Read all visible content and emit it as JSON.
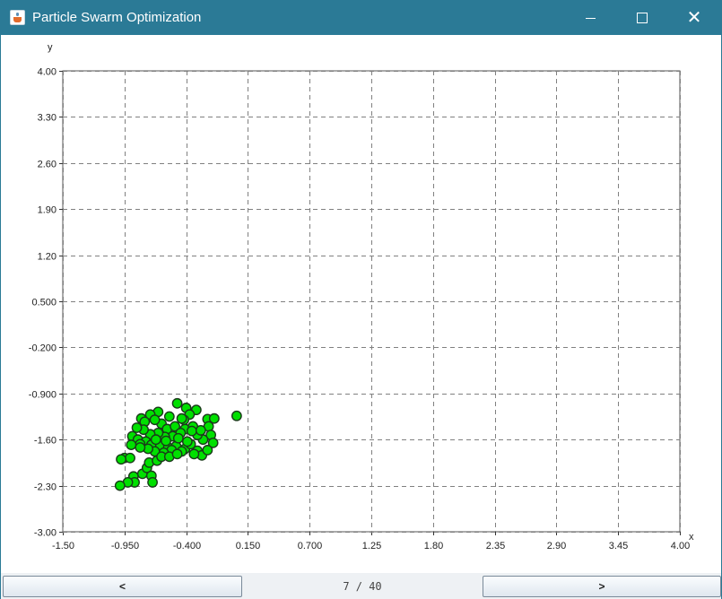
{
  "window": {
    "title": "Particle Swarm Optimization"
  },
  "controls": {
    "minimize_icon": "minimize-icon",
    "maximize_icon": "maximize-icon",
    "close_icon": "close-icon",
    "close_glyph": "✕"
  },
  "navigation": {
    "prev_label": "<",
    "next_label": ">",
    "page_indicator": "7 / 40"
  },
  "colors": {
    "titlebar": "#2b7a96",
    "point_fill": "#00e000",
    "point_stroke": "#1a3a1a",
    "grid": "#808080"
  },
  "chart_data": {
    "type": "scatter",
    "xlabel": "x",
    "ylabel": "y",
    "xlim": [
      -1.5,
      4.0
    ],
    "ylim": [
      -3.0,
      4.0
    ],
    "x_ticks": [
      "-1.50",
      "-0.950",
      "-0.400",
      "0.150",
      "0.700",
      "1.25",
      "1.80",
      "2.35",
      "2.90",
      "3.45",
      "4.00"
    ],
    "y_ticks": [
      "4.00",
      "3.30",
      "2.60",
      "1.90",
      "1.20",
      "0.500",
      "-0.200",
      "-0.900",
      "-1.60",
      "-2.30",
      "-3.00"
    ],
    "grid": true,
    "points": [
      [
        -0.48,
        -1.05
      ],
      [
        -0.4,
        -1.12
      ],
      [
        -0.31,
        -1.15
      ],
      [
        -0.37,
        -1.22
      ],
      [
        -0.42,
        -1.3
      ],
      [
        -0.55,
        -1.25
      ],
      [
        -0.65,
        -1.18
      ],
      [
        -0.72,
        -1.22
      ],
      [
        -0.8,
        -1.28
      ],
      [
        -0.77,
        -1.33
      ],
      [
        -0.62,
        -1.36
      ],
      [
        -0.57,
        -1.44
      ],
      [
        -0.5,
        -1.4
      ],
      [
        -0.41,
        -1.44
      ],
      [
        -0.34,
        -1.4
      ],
      [
        -0.21,
        -1.29
      ],
      [
        -0.15,
        -1.28
      ],
      [
        0.05,
        -1.24
      ],
      [
        -0.2,
        -1.4
      ],
      [
        -0.18,
        -1.53
      ],
      [
        -0.16,
        -1.65
      ],
      [
        -0.25,
        -1.6
      ],
      [
        -0.3,
        -1.53
      ],
      [
        -0.35,
        -1.47
      ],
      [
        -0.45,
        -1.5
      ],
      [
        -0.52,
        -1.55
      ],
      [
        -0.59,
        -1.56
      ],
      [
        -0.65,
        -1.5
      ],
      [
        -0.72,
        -1.52
      ],
      [
        -0.78,
        -1.45
      ],
      [
        -0.84,
        -1.42
      ],
      [
        -0.88,
        -1.55
      ],
      [
        -0.83,
        -1.6
      ],
      [
        -0.76,
        -1.63
      ],
      [
        -0.71,
        -1.68
      ],
      [
        -0.63,
        -1.69
      ],
      [
        -0.56,
        -1.72
      ],
      [
        -0.49,
        -1.7
      ],
      [
        -0.41,
        -1.74
      ],
      [
        -0.36,
        -1.67
      ],
      [
        -0.3,
        -1.77
      ],
      [
        -0.26,
        -1.84
      ],
      [
        -0.21,
        -1.76
      ],
      [
        -0.33,
        -1.82
      ],
      [
        -0.44,
        -1.78
      ],
      [
        -0.53,
        -1.76
      ],
      [
        -0.6,
        -1.8
      ],
      [
        -0.68,
        -1.78
      ],
      [
        -0.74,
        -1.74
      ],
      [
        -0.81,
        -1.67
      ],
      [
        -0.89,
        -1.68
      ],
      [
        -0.95,
        -1.88
      ],
      [
        -0.9,
        -1.88
      ],
      [
        -0.98,
        -1.9
      ],
      [
        -0.87,
        -2.16
      ],
      [
        -0.79,
        -2.12
      ],
      [
        -0.75,
        -2.03
      ],
      [
        -0.71,
        -2.15
      ],
      [
        -0.7,
        -2.25
      ],
      [
        -0.86,
        -2.25
      ],
      [
        -0.92,
        -2.25
      ],
      [
        -0.99,
        -2.3
      ],
      [
        -0.73,
        -1.95
      ],
      [
        -0.66,
        -1.92
      ],
      [
        -0.62,
        -1.86
      ],
      [
        -0.55,
        -1.86
      ],
      [
        -0.48,
        -1.82
      ],
      [
        -0.58,
        -1.62
      ],
      [
        -0.67,
        -1.6
      ],
      [
        -0.47,
        -1.58
      ],
      [
        -0.39,
        -1.63
      ],
      [
        -0.27,
        -1.46
      ],
      [
        -0.44,
        -1.28
      ],
      [
        -0.68,
        -1.3
      ],
      [
        -0.81,
        -1.72
      ]
    ]
  }
}
